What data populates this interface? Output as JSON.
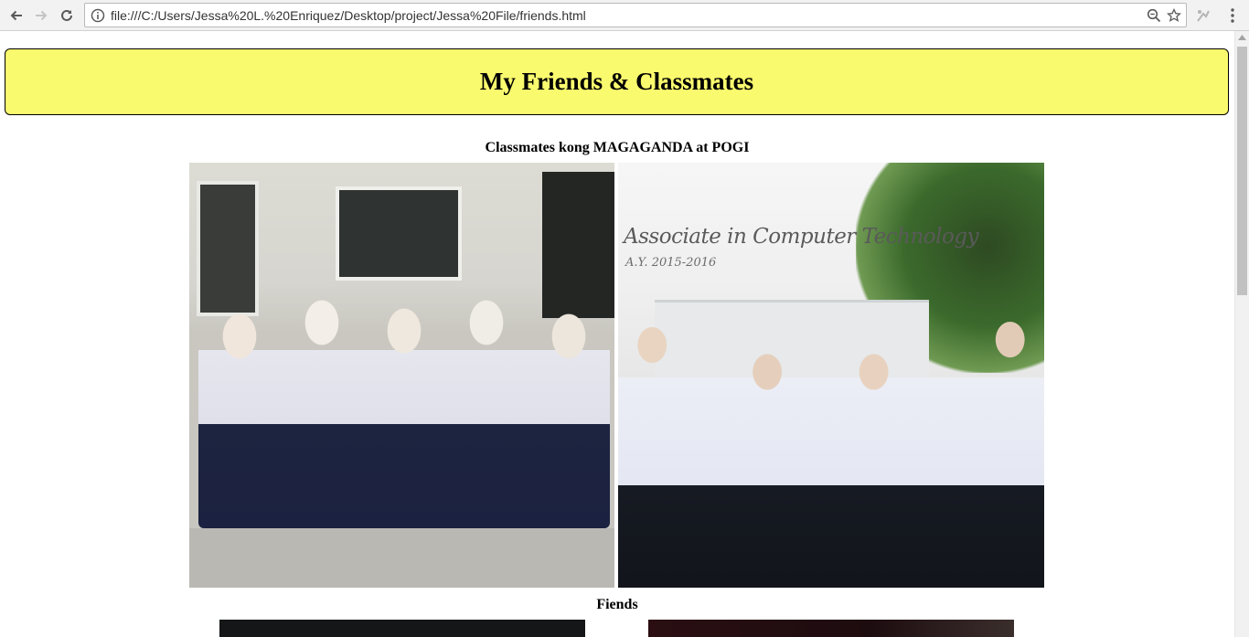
{
  "browser": {
    "url": "file:///C:/Users/Jessa%20L.%20Enriquez/Desktop/project/Jessa%20File/friends.html",
    "icons": {
      "back": "back-arrow-icon",
      "forward": "forward-arrow-icon",
      "reload": "reload-icon",
      "info": "info-icon",
      "zoom": "zoom-icon",
      "bookmark": "star-icon",
      "extension": "extension-icon",
      "menu": "kebab-menu-icon"
    }
  },
  "page": {
    "header_title": "My Friends & Classmates",
    "header_bg": "#fafa6e",
    "sections": [
      {
        "heading": "Classmates kong MAGAGANDA at POGI",
        "photos": [
          {
            "caption": ""
          },
          {
            "caption": "Associate in Computer Technology",
            "subcaption": "A.Y. 2015-2016"
          }
        ]
      },
      {
        "heading": "Fiends"
      }
    ]
  }
}
